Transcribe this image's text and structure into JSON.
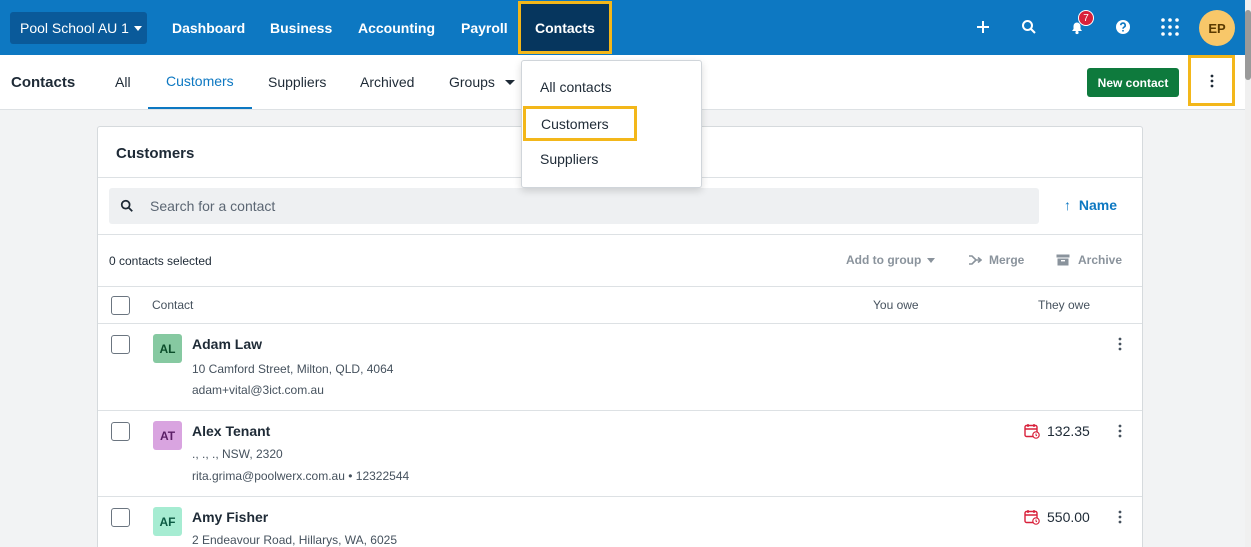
{
  "topnav": {
    "org": "Pool School AU 1",
    "items": [
      "Dashboard",
      "Business",
      "Accounting",
      "Payroll",
      "Contacts"
    ],
    "notification_count": "7",
    "user_initials": "EP"
  },
  "subnav": {
    "title": "Contacts",
    "tabs": [
      "All",
      "Customers",
      "Suppliers",
      "Archived",
      "Groups"
    ],
    "new_contact": "New contact"
  },
  "dropdown": {
    "items": [
      "All contacts",
      "Customers",
      "Suppliers"
    ]
  },
  "card": {
    "title": "Customers",
    "search_placeholder": "Search for a contact",
    "sort_label": "Name",
    "selected_count": "0 contacts selected",
    "actions": {
      "add_to_group": "Add to group",
      "merge": "Merge",
      "archive": "Archive"
    },
    "columns": {
      "contact": "Contact",
      "you_owe": "You owe",
      "they_owe": "They owe"
    },
    "rows": [
      {
        "initials": "AL",
        "name": "Adam Law",
        "address": "10 Camford Street, Milton, QLD, 4064",
        "contact_line": "adam+vital@3ict.com.au",
        "they_owe": "",
        "avatar_bg": "#86c9a1",
        "avatar_fg": "#0b4d2a"
      },
      {
        "initials": "AT",
        "name": "Alex Tenant",
        "address": "., ., ., NSW, 2320",
        "contact_line": "rita.grima@poolwerx.com.au  •  12322544",
        "they_owe": "132.35",
        "avatar_bg": "#d9a4e0",
        "avatar_fg": "#5a1f66"
      },
      {
        "initials": "AF",
        "name": "Amy Fisher",
        "address": "2 Endeavour Road, Hillarys, WA, 6025",
        "contact_line": "",
        "they_owe": "550.00",
        "avatar_bg": "#a6ecd2",
        "avatar_fg": "#0b5a43"
      }
    ]
  },
  "colors": {
    "nav_blue": "#0d78c2",
    "active_nav": "#06365e",
    "highlight": "#f3b71a",
    "primary_green": "#0e7a3d",
    "overdue_red": "#d8203a"
  }
}
